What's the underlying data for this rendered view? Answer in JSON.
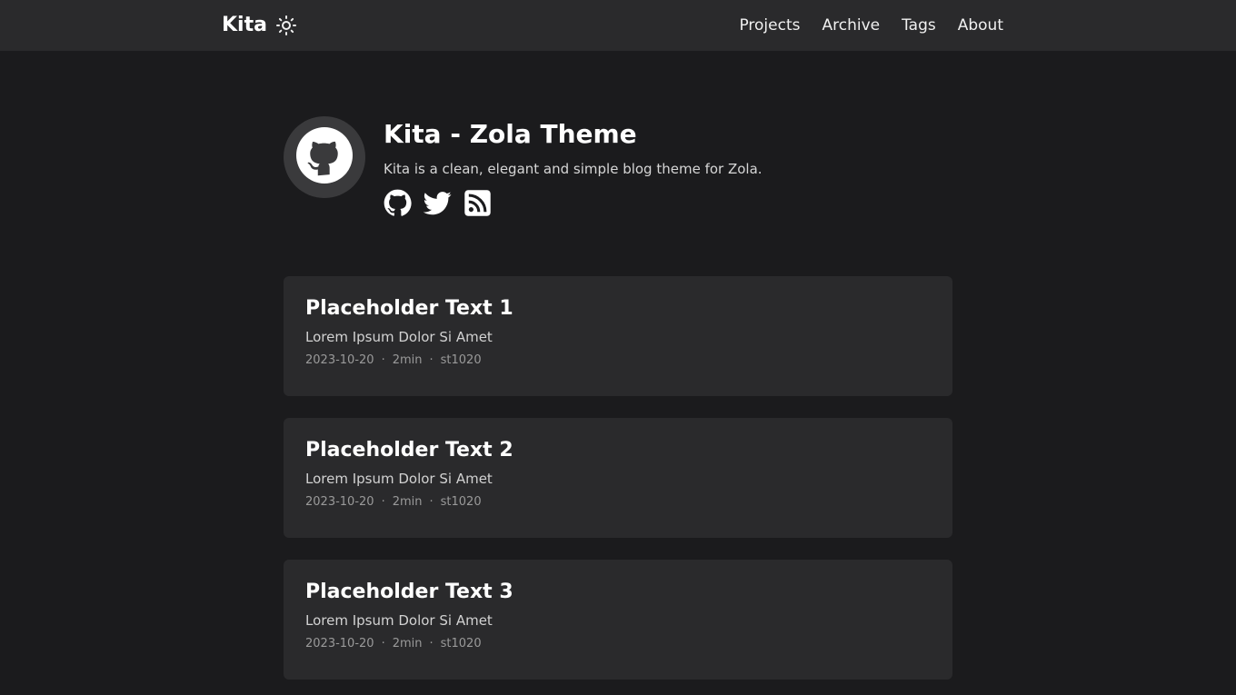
{
  "header": {
    "site_title": "Kita",
    "theme_toggle_icon": "sun-icon",
    "nav": [
      "Projects",
      "Archive",
      "Tags",
      "About"
    ]
  },
  "profile": {
    "avatar_icon": "github-icon",
    "name": "Kita - Zola Theme",
    "bio": "Kita is a clean, elegant and simple blog theme for Zola.",
    "social_icons": [
      "github-icon",
      "twitter-icon",
      "rss-icon"
    ]
  },
  "posts": [
    {
      "title": "Placeholder Text 1",
      "description": "Lorem Ipsum Dolor Si Amet",
      "date": "2023-10-20",
      "reading_time": "2min",
      "author": "st1020"
    },
    {
      "title": "Placeholder Text 2",
      "description": "Lorem Ipsum Dolor Si Amet",
      "date": "2023-10-20",
      "reading_time": "2min",
      "author": "st1020"
    },
    {
      "title": "Placeholder Text 3",
      "description": "Lorem Ipsum Dolor Si Amet",
      "date": "2023-10-20",
      "reading_time": "2min",
      "author": "st1020"
    }
  ],
  "meta_separator": "·",
  "colors": {
    "background": "#1b1b1d",
    "surface": "#2a2a2c",
    "text": "#ffffff",
    "muted": "#9a9a9a"
  }
}
